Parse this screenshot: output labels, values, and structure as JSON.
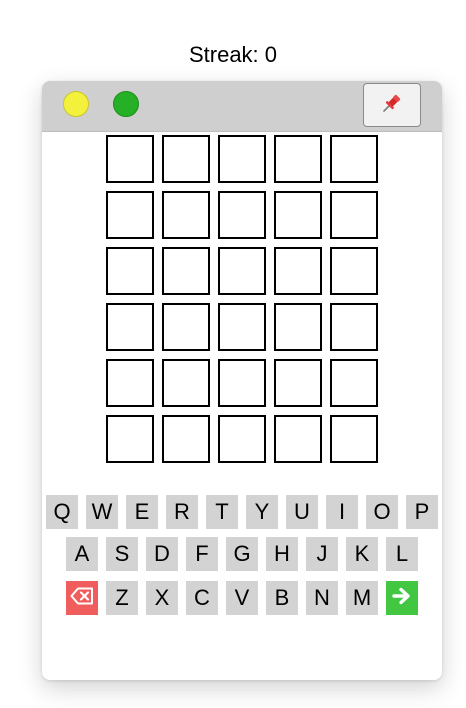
{
  "header": {
    "streak_text": "Streak: 0"
  },
  "window": {
    "pin_icon": "pushpin-icon",
    "traffic_lights": [
      {
        "name": "yellow",
        "color": "#f4f13d"
      },
      {
        "name": "green",
        "color": "#25b026"
      }
    ]
  },
  "board": {
    "rows": [
      [
        "",
        "",
        "",
        "",
        ""
      ],
      [
        "",
        "",
        "",
        "",
        ""
      ],
      [
        "",
        "",
        "",
        "",
        ""
      ],
      [
        "",
        "",
        "",
        "",
        ""
      ],
      [
        "",
        "",
        "",
        "",
        ""
      ],
      [
        "",
        "",
        "",
        "",
        ""
      ]
    ]
  },
  "keyboard": {
    "row1": [
      "Q",
      "W",
      "E",
      "R",
      "T",
      "Y",
      "U",
      "I",
      "O",
      "P"
    ],
    "row2": [
      "A",
      "S",
      "D",
      "F",
      "G",
      "H",
      "J",
      "K",
      "L"
    ],
    "row3": [
      "Z",
      "X",
      "C",
      "V",
      "B",
      "N",
      "M"
    ],
    "backspace_icon": "backspace-icon",
    "enter_icon": "arrow-right-icon",
    "backspace_color": "#ef5d5d",
    "enter_color": "#43c743",
    "key_color": "#d3d3d3"
  }
}
